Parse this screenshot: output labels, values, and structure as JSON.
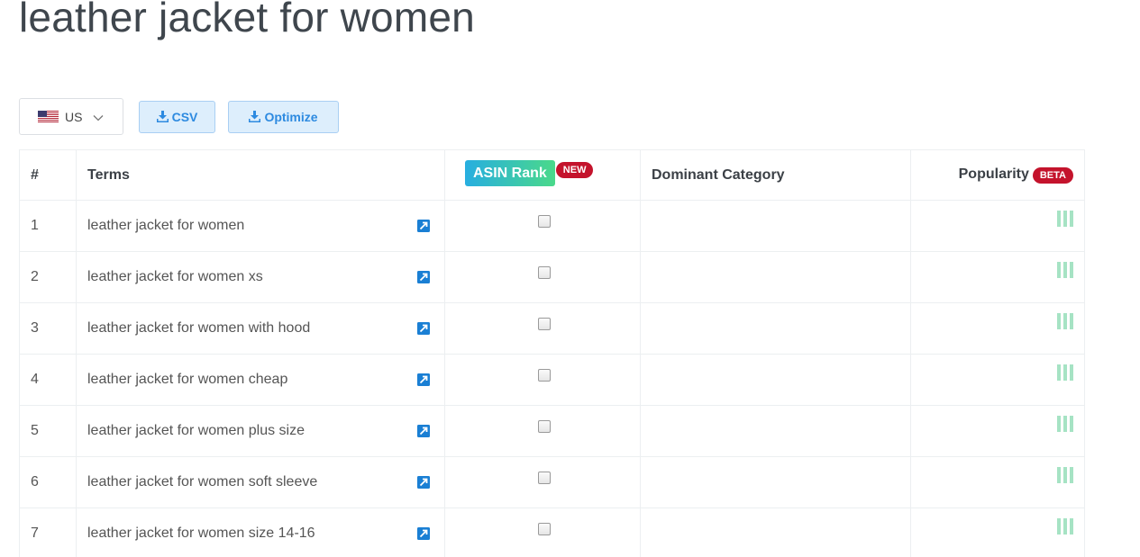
{
  "page_title": "leather jacket for women",
  "toolbar": {
    "country": "US",
    "flag_icon": "us-flag-icon",
    "csv_label": "CSV",
    "optimize_label": "Optimize",
    "button_color": "#2d8ae0"
  },
  "table": {
    "headers": {
      "num": "#",
      "terms": "Terms",
      "asin_rank": "ASIN Rank",
      "asin_badge": "NEW",
      "dominant_category": "Dominant Category",
      "popularity": "Popularity",
      "popularity_badge": "BETA"
    },
    "rows": [
      {
        "num": "1",
        "term": "leather jacket for women",
        "asin_checked": false,
        "dominant_category": "",
        "popularity_bars": 3
      },
      {
        "num": "2",
        "term": "leather jacket for women xs",
        "asin_checked": false,
        "dominant_category": "",
        "popularity_bars": 3
      },
      {
        "num": "3",
        "term": "leather jacket for women with hood",
        "asin_checked": false,
        "dominant_category": "",
        "popularity_bars": 3
      },
      {
        "num": "4",
        "term": "leather jacket for women cheap",
        "asin_checked": false,
        "dominant_category": "",
        "popularity_bars": 3
      },
      {
        "num": "5",
        "term": "leather jacket for women plus size",
        "asin_checked": false,
        "dominant_category": "",
        "popularity_bars": 3
      },
      {
        "num": "6",
        "term": "leather jacket for women soft sleeve",
        "asin_checked": false,
        "dominant_category": "",
        "popularity_bars": 3
      },
      {
        "num": "7",
        "term": "leather jacket for women size 14-16",
        "asin_checked": false,
        "dominant_category": "",
        "popularity_bars": 3
      }
    ]
  },
  "colors": {
    "badge_red": "#c4132c",
    "asin_gradient_start": "#27aee0",
    "asin_gradient_end": "#4ad98a",
    "popularity_bar": "#a6e3c4",
    "external_link_icon": "#1a7fd4"
  }
}
